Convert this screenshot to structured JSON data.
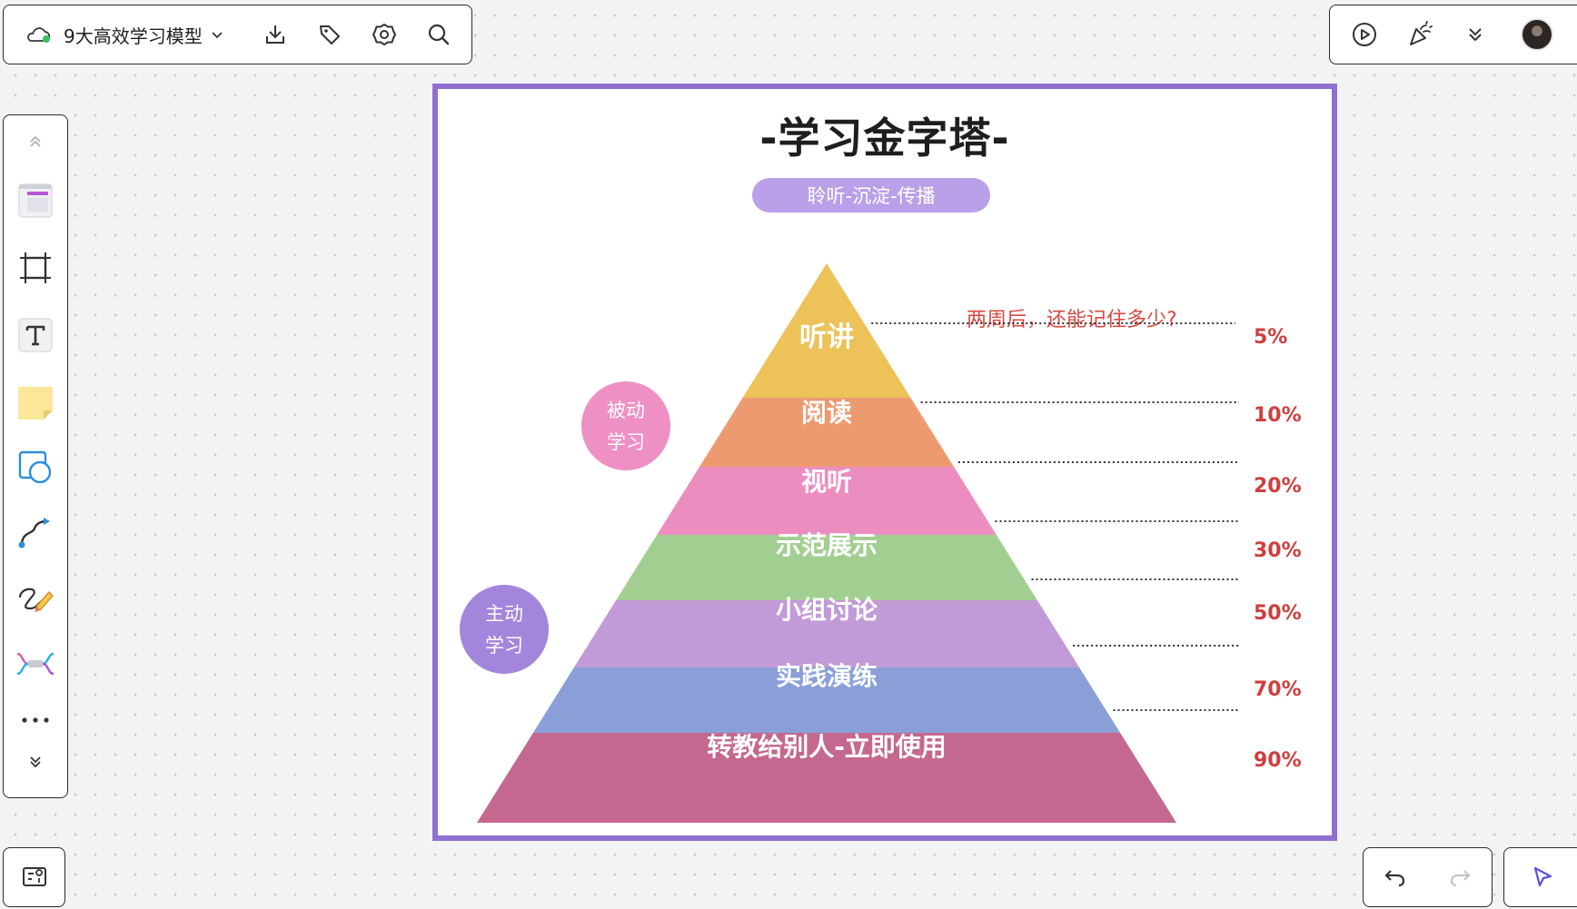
{
  "topbar": {
    "doc_title": "9大高效学习模型"
  },
  "card": {
    "title": "-学习金字塔-",
    "subtitle": "聆听-沉淀-传播",
    "question": "两周后，还能记住多少?",
    "passive_label": [
      "被动",
      "学习"
    ],
    "active_label": [
      "主动",
      "学习"
    ],
    "levels": [
      {
        "label": "听讲",
        "percent": "5%",
        "color": "#ecc259"
      },
      {
        "label": "阅读",
        "percent": "10%",
        "color": "#ee9a71"
      },
      {
        "label": "视听",
        "percent": "20%",
        "color": "#ec8dc0"
      },
      {
        "label": "示范展示",
        "percent": "30%",
        "color": "#a2cf91"
      },
      {
        "label": "小组讨论",
        "percent": "50%",
        "color": "#c39ad8"
      },
      {
        "label": "实践演练",
        "percent": "70%",
        "color": "#8a9fd8"
      },
      {
        "label": "转教给别人-立即使用",
        "percent": "90%",
        "color": "#c4688f"
      }
    ],
    "colors": {
      "frame": "#8f6fd0",
      "pill": "#b9a0e8",
      "passive_bubble": "#ee90c4",
      "active_bubble": "#a386dc",
      "percent_text": "#cf3f3f"
    }
  },
  "icons": {
    "topbar": [
      "cloud-sync-icon",
      "download-icon",
      "tag-icon",
      "settings-icon",
      "search-icon"
    ],
    "topbar_right": [
      "present-icon",
      "celebrate-icon",
      "expand-more-icon",
      "avatar"
    ],
    "sidebar": [
      "collapse-up-icon",
      "template-icon",
      "frame-icon",
      "text-icon",
      "sticky-note-icon",
      "shape-icon",
      "connector-icon",
      "pen-icon",
      "mindmap-icon",
      "more-icon",
      "expand-down-icon"
    ],
    "bottom": [
      "minimap-icon",
      "undo-icon",
      "redo-icon",
      "pointer-icon"
    ]
  }
}
